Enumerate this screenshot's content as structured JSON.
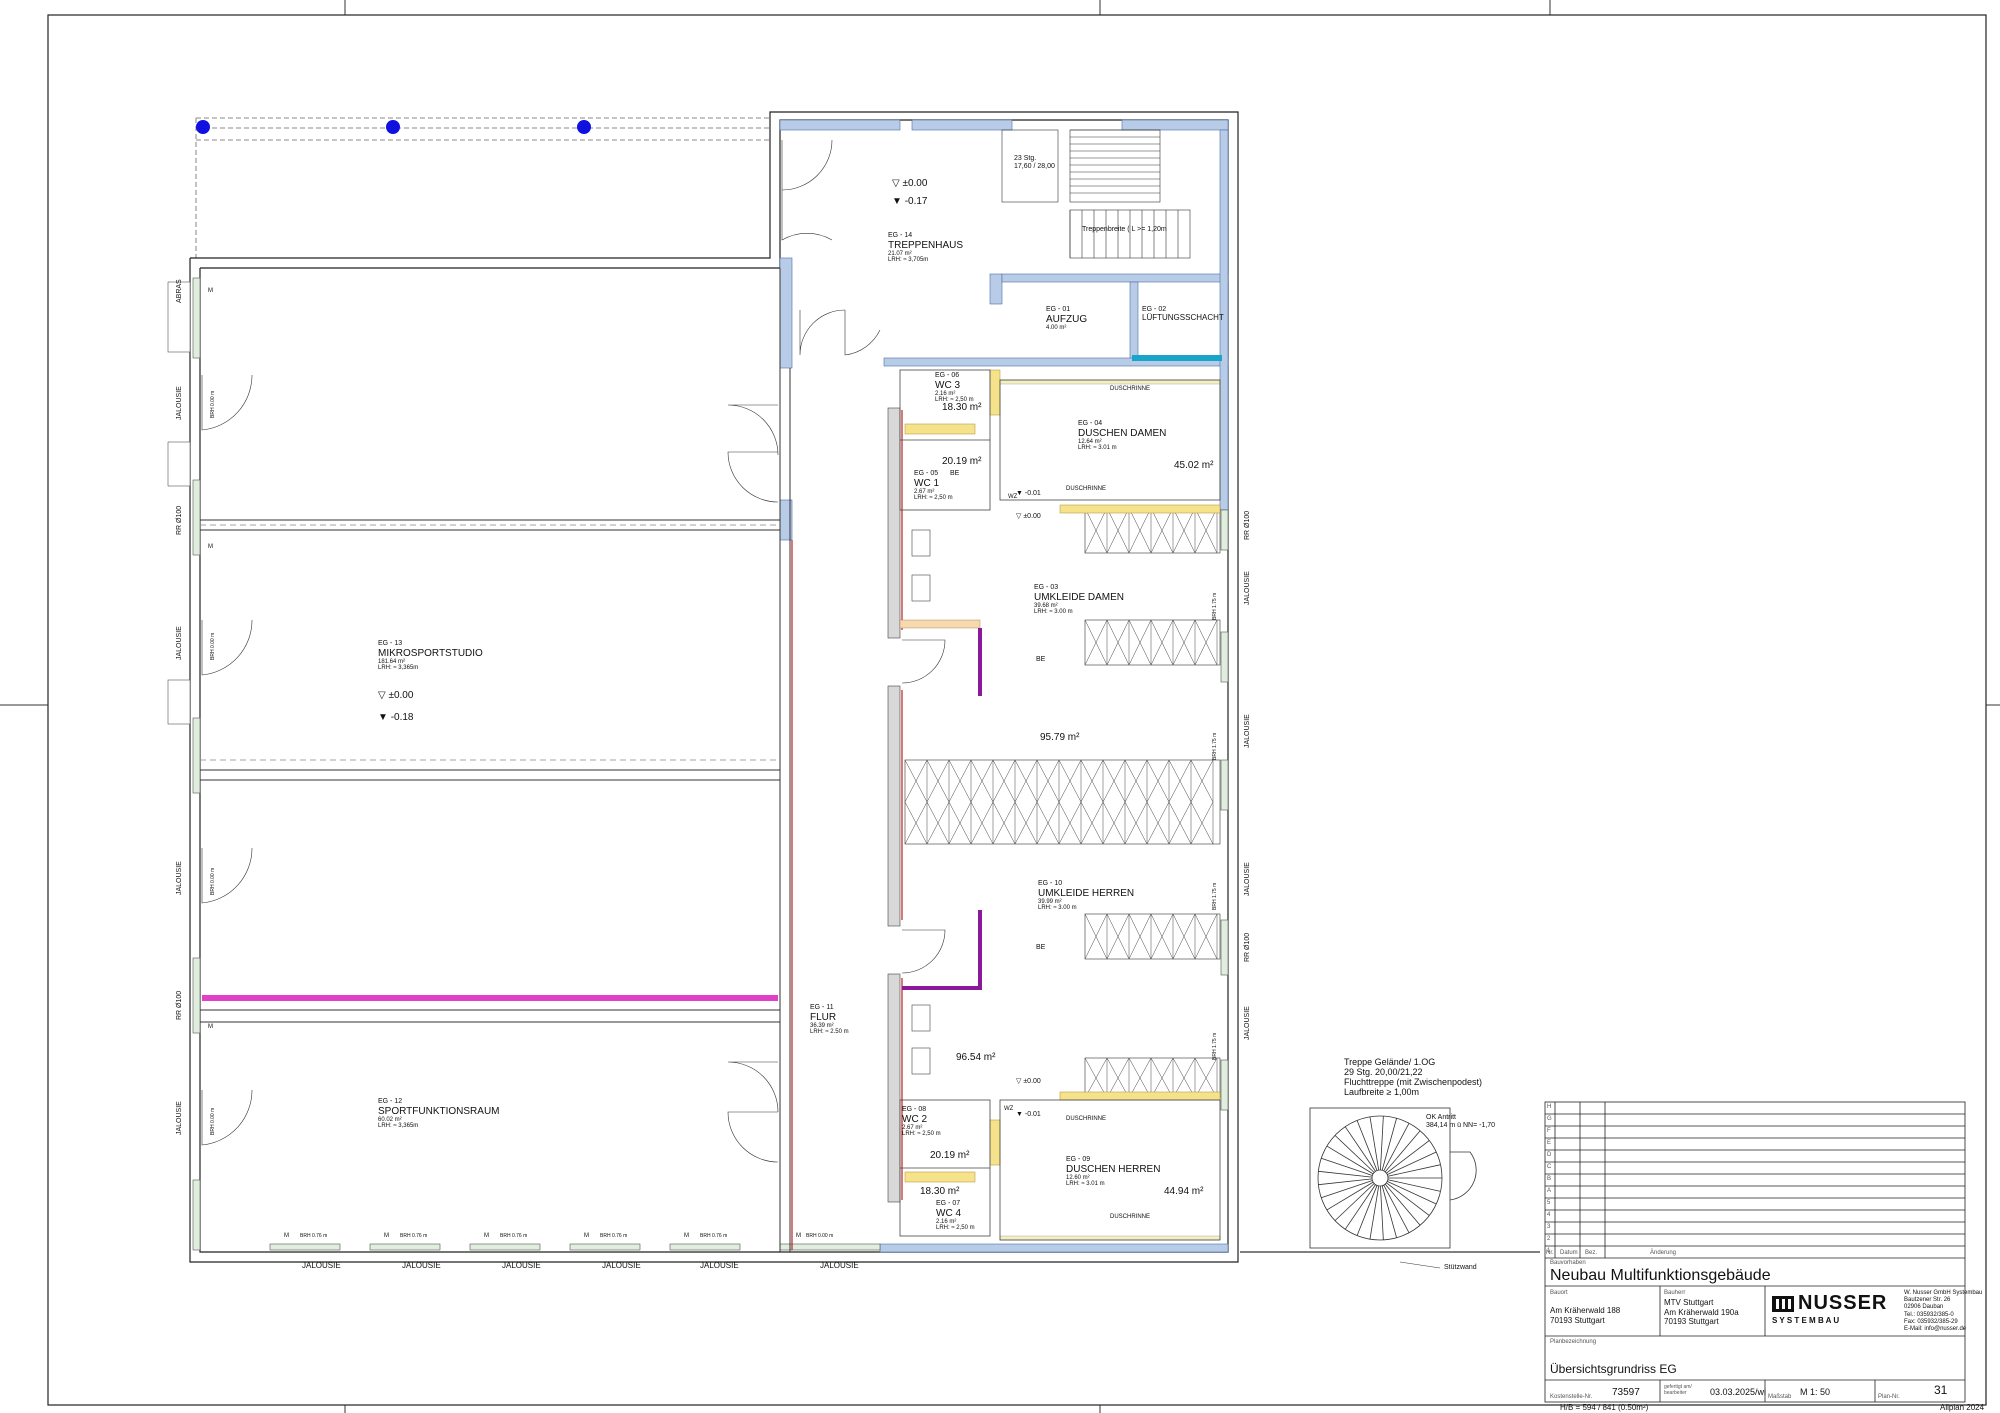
{
  "rooms": {
    "r14": {
      "code": "EG - 14",
      "name": "TREPPENHAUS",
      "area": "21.07 m²",
      "lrh": "LRH: ≈ 3,705m"
    },
    "r01": {
      "code": "EG - 01",
      "name": "AUFZUG",
      "area": "4.00 m²"
    },
    "r02": {
      "code": "EG - 02",
      "name": "LÜFTUNGSSCHACHT"
    },
    "r06": {
      "code": "EG - 06",
      "name": "WC 3",
      "area": "2.16 m²",
      "lrh": "LRH: ≈ 2,50 m"
    },
    "r05": {
      "code": "EG - 05",
      "name": "WC 1",
      "area": "2.67 m²",
      "lrh": "LRH: ≈ 2,50 m"
    },
    "r04": {
      "code": "EG - 04",
      "name": "DUSCHEN DAMEN",
      "area": "12.64 m²",
      "lrh": "LRH: ≈ 3.01 m"
    },
    "r03": {
      "code": "EG - 03",
      "name": "UMKLEIDE DAMEN",
      "area": "39.68 m²",
      "lrh": "LRH: ≈ 3.00 m"
    },
    "r13": {
      "code": "EG - 13",
      "name": "MIKROSPORTSTUDIO",
      "area": "181.64 m²",
      "lrh": "LRH: ≈ 3,365m"
    },
    "r10": {
      "code": "EG - 10",
      "name": "UMKLEIDE HERREN",
      "area": "39.99 m²",
      "lrh": "LRH: ≈ 3.00 m"
    },
    "r11": {
      "code": "EG - 11",
      "name": "FLUR",
      "area": "36.39 m²",
      "lrh": "LRH: ≈ 2.50 m"
    },
    "r12": {
      "code": "EG - 12",
      "name": "SPORTFUNKTIONSRAUM",
      "area": "60.02 m²",
      "lrh": "LRH: ≈ 3,365m"
    },
    "r08": {
      "code": "EG - 08",
      "name": "WC 2",
      "area": "2.67 m²",
      "lrh": "LRH: ≈ 2,50 m"
    },
    "r09": {
      "code": "EG - 09",
      "name": "DUSCHEN HERREN",
      "area": "12.60 m²",
      "lrh": "LRH: ≈ 3.01 m"
    },
    "r07": {
      "code": "EG - 07",
      "name": "WC 4",
      "area": "2.16 m²",
      "lrh": "LRH: ≈ 2,50 m"
    }
  },
  "areas": {
    "a1830a": "18.30 m²",
    "a2019a": "20.19 m²",
    "a4502": "45.02 m²",
    "a9579": "95.79 m²",
    "a9654": "96.54 m²",
    "a2019b": "20.19 m²",
    "a1830b": "18.30 m²",
    "a4494": "44.94 m²"
  },
  "levels": {
    "l1": "±0.00",
    "l2": "-0.17",
    "l3": "±0.00",
    "l4": "-0.18",
    "l5": "-0.01",
    "l6": "±0.00",
    "l7": "±0.00",
    "l8": "-0.01"
  },
  "stairs": {
    "steps": "23 Stg.",
    "ratio": "17,60 / 28,00",
    "width": "Treppenbreite ( L >= 1,20m"
  },
  "labels": {
    "duschrinne": "DUSCHRINNE",
    "be": "BE",
    "wz": "WZ",
    "jalousie": "JALOUSIE",
    "abras": "ABRAS",
    "rr": "RR Ø100",
    "brh": "BRH 0.00 m",
    "brh076": "BRH 0.76 m",
    "brh175": "BRH 1.75 m",
    "m": "M",
    "stuetzwand": "Stützwand"
  },
  "spiral": {
    "t1": "Treppe Gelände/ 1.OG",
    "t2": "29 Stg. 20,00/21,22",
    "t3": "Fluchttreppe (mit Zwischenpodest)",
    "t4": "Laufbreite ≥ 1,00m",
    "ok1": "OK Antritt",
    "ok2": "384,14 m ü NN= -1,70"
  },
  "titleblock": {
    "rowLetters": [
      "H",
      "G",
      "F",
      "E",
      "D",
      "C",
      "B",
      "A"
    ],
    "rowNums": [
      "5",
      "4",
      "3",
      "2",
      "1"
    ],
    "col_nr": "Nr.",
    "col_datum": "Datum",
    "col_bez": "Bez.",
    "col_aenderung": "Änderung",
    "bauvorhaben_lbl": "Bauvorhaben",
    "project": "Neubau Multifunktionsgebäude",
    "bauort_lbl": "Bauort",
    "bauort1": "Am Kräherwald 188",
    "bauort2": "70193 Stuttgart",
    "bauherr_lbl": "Bauherr",
    "bauherr1": "MTV Stuttgart",
    "bauherr2": "Am Kräherwald 190a",
    "bauherr3": "70193 Stuttgart",
    "logo": "NUSSER",
    "logo_sub": "S Y S T E M B A U",
    "firm1": "W. Nusser GmbH Systembau",
    "firm2": "Bautzener Str. 26",
    "firm3": "02906 Dauban",
    "firm4": "Tel.: 035932/385-0",
    "firm5": "Fax: 035932/385-29",
    "firm6": "E-Mail: info@nusser.de",
    "planbez_lbl": "Planbezeichnung",
    "plan_title": "Übersichtsgrundriss EG",
    "kost_lbl": "Kostenstelle-Nr.",
    "kost": "73597",
    "gez_lbl": "gefertigt am/ bearbeiter",
    "gez": "03.03.2025/wi",
    "mass_lbl": "Maßstab",
    "mass": "M 1: 50",
    "plannr_lbl": "Plan-Nr.",
    "plannr": "31",
    "hb": "H/B = 594 / 841 (0.50m²)",
    "software": "Allplan 2024"
  }
}
